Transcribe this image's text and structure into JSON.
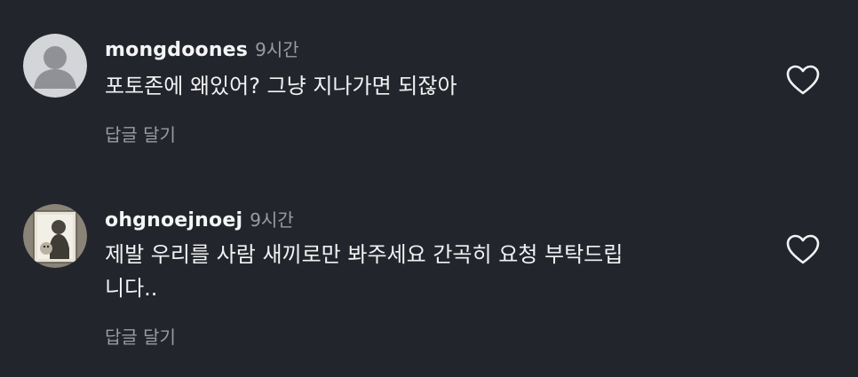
{
  "comments": [
    {
      "username": "mongdoones",
      "time": "9시간",
      "text": "포토존에 왜있어? 그냥 지나가면 되잖아",
      "reply_label": "답글 달기",
      "avatar": "default-user-avatar"
    },
    {
      "username": "ohgnoejnoej",
      "time": "9시간",
      "text": "제발 우리를 사람 새끼로만 봐주세요 간곡히 요청 부탁드립\n니다..",
      "reply_label": "답글 달기",
      "avatar": "sketch-portrait-avatar"
    }
  ],
  "icons": {
    "like": "heart-outline-icon"
  },
  "colors": {
    "background": "#22252c",
    "primary_text": "#f5f5f5",
    "secondary_text": "#9a9ca3"
  }
}
